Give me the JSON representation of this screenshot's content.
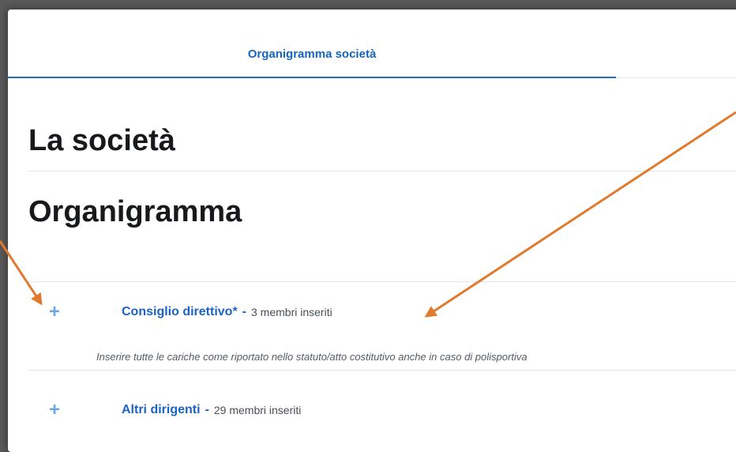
{
  "tabs": [
    {
      "label": "Organigramma società",
      "active": true
    }
  ],
  "headings": {
    "company": "La società",
    "org_chart": "Organigramma"
  },
  "sections": [
    {
      "title": "Consiglio direttivo*",
      "separator": "-",
      "members": "3 membri inseriti",
      "hint": "Inserire tutte le cariche come riportato nello statuto/atto costitutivo anche in caso di polisportiva"
    },
    {
      "title": "Altri dirigenti",
      "separator": "-",
      "members": "29 membri inseriti"
    }
  ],
  "icons": {
    "expand": "plus-icon"
  },
  "colors": {
    "accent": "#1b63c6",
    "annotation_arrow": "#e07a2e"
  }
}
